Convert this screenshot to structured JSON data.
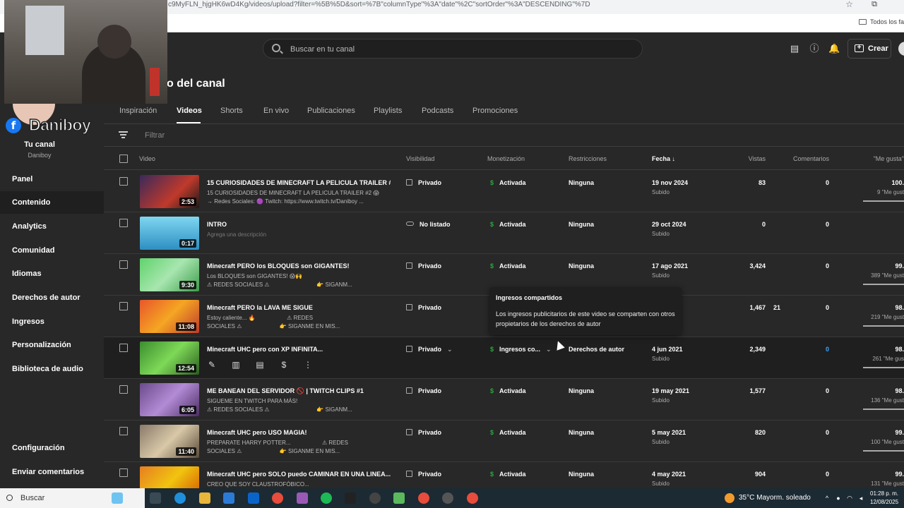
{
  "browser": {
    "url": "c9MyFLN_hjgHK6wD4Kg/videos/upload?filter=%5B%5D&sort=%7B\"columnType\"%3A\"date\"%2C\"sortOrder\"%3A\"DESCENDING\"%7D",
    "bookmarks_folder": "Todos los fa"
  },
  "header": {
    "search_placeholder": "Buscar en tu canal",
    "create_label": "Crear"
  },
  "page_title": "o del canal",
  "sidebar": {
    "brand": "Daniboy",
    "facebook_glyph": "f",
    "your_channel": "Tu canal",
    "channel_name": "Daniboy",
    "items": [
      {
        "label": "Panel"
      },
      {
        "label": "Contenido"
      },
      {
        "label": "Analytics"
      },
      {
        "label": "Comunidad"
      },
      {
        "label": "Idiomas"
      },
      {
        "label": "Derechos de autor"
      },
      {
        "label": "Ingresos"
      },
      {
        "label": "Personalización"
      },
      {
        "label": "Biblioteca de audio"
      }
    ],
    "bottom_items": [
      {
        "label": "Configuración"
      },
      {
        "label": "Enviar comentarios"
      }
    ]
  },
  "tabs": [
    {
      "label": "Inspiración"
    },
    {
      "label": "Videos"
    },
    {
      "label": "Shorts"
    },
    {
      "label": "En vivo"
    },
    {
      "label": "Publicaciones"
    },
    {
      "label": "Playlists"
    },
    {
      "label": "Podcasts"
    },
    {
      "label": "Promociones"
    }
  ],
  "filter_placeholder": "Filtrar",
  "columns": {
    "video": "Video",
    "visibility": "Visibilidad",
    "monetization": "Monetización",
    "restrictions": "Restricciones",
    "date": "Fecha",
    "views": "Vistas",
    "comments": "Comentarios",
    "likes": "\"Me gusta\""
  },
  "rows": [
    {
      "title": "15 CURIOSIDADES DE MINECRAFT LA PELICULA TRAILER #2...",
      "desc1": "15 CURIOSIDADES DE MINECRAFT LA PELICULA TRAILER #2 😱",
      "desc2": "→ Redes Sociales: 🟣 Twitch: https://www.twitch.tv/Daniboy ...",
      "duration": "2:53",
      "visibility": "Privado",
      "monetization": "Activada",
      "restrictions": "Ninguna",
      "date": "19 nov 2024",
      "date_sub": "Subido",
      "views": "83",
      "comments": "0",
      "likes": "100.",
      "likes_sub": "9 \"Me gust"
    },
    {
      "title": "INTRO",
      "desc1": "Agrega una descripción",
      "desc2": "",
      "duration": "0:17",
      "visibility": "No listado",
      "monetization": "Activada",
      "restrictions": "Ninguna",
      "date": "29 oct 2024",
      "date_sub": "Subido",
      "views": "0",
      "comments": "0",
      "likes": "",
      "likes_sub": ""
    },
    {
      "title": "Minecraft PERO los BLOQUES son GIGANTES!",
      "desc1": "Los BLOQUES son GIGANTES! 😱🙌",
      "desc2": "⚠ REDES SOCIALES ⚠                              👉 SIGANM...",
      "duration": "9:30",
      "visibility": "Privado",
      "monetization": "Activada",
      "restrictions": "Ninguna",
      "date": "17 ago 2021",
      "date_sub": "Subido",
      "views": "3,424",
      "comments": "0",
      "likes": "99.",
      "likes_sub": "389 \"Me gust"
    },
    {
      "title": "Minecraft PERO la LAVA ME SIGUE",
      "desc1": "Estoy caliente... 🔥                    ⚠ REDES",
      "desc2": "SOCIALES ⚠                        👉 SIGANME EN MIS...",
      "duration": "11:08",
      "visibility": "Privado",
      "monetization": "",
      "restrictions": "",
      "date": "21",
      "date_sub": "",
      "views": "1,467",
      "comments": "0",
      "likes": "98.",
      "likes_sub": "219 \"Me gust"
    },
    {
      "title": "Minecraft UHC pero con XP INFINITA...",
      "desc1": "",
      "desc2": "",
      "duration": "12:54",
      "visibility": "Privado",
      "monetization": "Ingresos co...",
      "restrictions": "Derechos de autor",
      "date": "4 jun 2021",
      "date_sub": "Subido",
      "views": "2,349",
      "comments": "0",
      "likes": "98.",
      "likes_sub": "261 \"Me gus"
    },
    {
      "title": "ME BANEAN DEL SERVIDOR 🚫 | TWITCH CLIPS #1",
      "desc1": "SIGUEME EN TWITCH PARA MÁS!",
      "desc2": "⚠ REDES SOCIALES ⚠                              👉 SIGANM...",
      "duration": "6:05",
      "visibility": "Privado",
      "monetization": "Activada",
      "restrictions": "Ninguna",
      "date": "19 may 2021",
      "date_sub": "Subido",
      "views": "1,577",
      "comments": "0",
      "likes": "98.",
      "likes_sub": "136 \"Me gust"
    },
    {
      "title": "Minecraft UHC pero USO MAGIA!",
      "desc1": "PREPARATE HARRY POTTER...                    ⚠ REDES",
      "desc2": "SOCIALES ⚠                        👉 SIGANME EN MIS...",
      "duration": "11:40",
      "visibility": "Privado",
      "monetization": "Activada",
      "restrictions": "Ninguna",
      "date": "5 may 2021",
      "date_sub": "Subido",
      "views": "820",
      "comments": "0",
      "likes": "99.",
      "likes_sub": "100 \"Me gust"
    },
    {
      "title": "Minecraft UHC pero SOLO puedo CAMINAR EN UNA LINEA...",
      "desc1": "CREO QUE SOY CLAUSTROFÓBICO...",
      "desc2": "",
      "duration": "",
      "visibility": "Privado",
      "monetization": "Activada",
      "restrictions": "Ninguna",
      "date": "4 may 2021",
      "date_sub": "Subido",
      "views": "904",
      "comments": "0",
      "likes": "99.",
      "likes_sub": "131 \"Me gust"
    }
  ],
  "tooltip": {
    "title": "Ingresos compartidos",
    "body": "Los ingresos publicitarios de este video se comparten con otros propietarios de los derechos de autor"
  },
  "taskbar": {
    "search_label": "Buscar",
    "weather": "35°C  Mayorm. soleado",
    "time": "01:28 p. m.",
    "date": "12/08/2025"
  },
  "colors": {
    "background": "#282828",
    "monetization_green": "#2ba640",
    "link_blue": "#3ea6ff",
    "taskbar": "#1c2a33"
  }
}
